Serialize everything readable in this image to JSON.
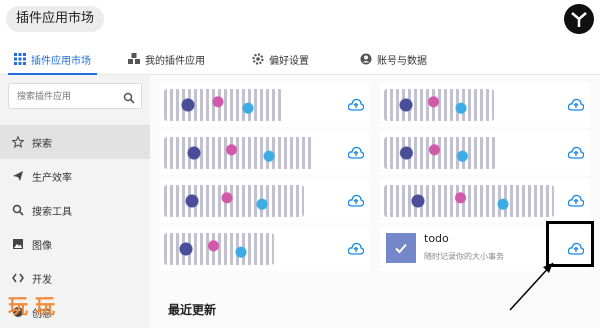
{
  "app": {
    "title": "插件应用市场"
  },
  "tabs": [
    {
      "label": "插件应用市场",
      "icon": "apps-grid-icon",
      "active": true
    },
    {
      "label": "我的插件应用",
      "icon": "cubes-icon",
      "active": false
    },
    {
      "label": "偏好设置",
      "icon": "gear-icon",
      "active": false
    },
    {
      "label": "账号与数据",
      "icon": "account-icon",
      "active": false
    }
  ],
  "sidebar": {
    "search_placeholder": "搜索插件应用",
    "items": [
      {
        "label": "探索",
        "icon": "star-icon",
        "active": true
      },
      {
        "label": "生产效率",
        "icon": "send-icon",
        "active": false
      },
      {
        "label": "搜索工具",
        "icon": "search-icon",
        "active": false
      },
      {
        "label": "图像",
        "icon": "image-icon",
        "active": false
      },
      {
        "label": "开发",
        "icon": "code-icon",
        "active": false
      },
      {
        "label": "创意",
        "icon": "palette-icon",
        "active": false
      }
    ]
  },
  "plugins": {
    "todo": {
      "title": "todo",
      "description": "随时记录你的大小事务"
    }
  },
  "sections": {
    "recent_title": "最近更新"
  },
  "watermark": "玩 玩",
  "colors": {
    "accent": "#1e6fd9",
    "download_icon": "#1e88e5",
    "todo_icon_bg": "#7387c9"
  }
}
